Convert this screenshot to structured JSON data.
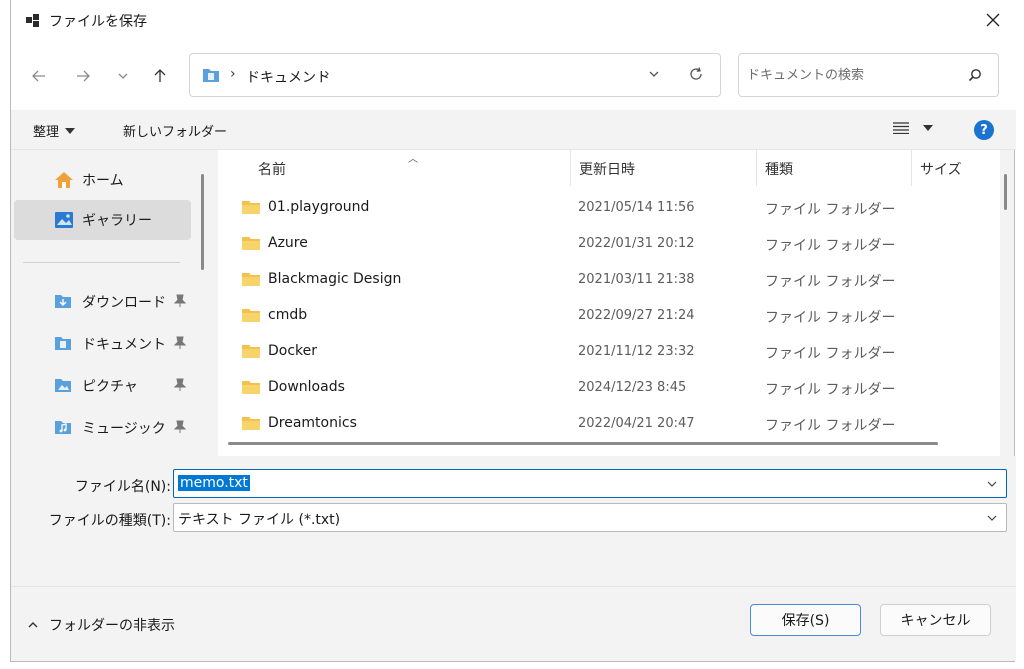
{
  "title": "ファイルを保存",
  "address": {
    "crumb": "ドキュメント",
    "sep": "›"
  },
  "search": {
    "placeholder": "ドキュメントの検索"
  },
  "toolbar": {
    "organize": "整理",
    "new_folder": "新しいフォルダー"
  },
  "sidebar": {
    "items": [
      {
        "label": "ホーム",
        "icon": "home-icon"
      },
      {
        "label": "ギャラリー",
        "icon": "gallery-icon",
        "selected": true
      },
      {
        "label": "ダウンロード",
        "icon": "downloads-folder-icon",
        "pinned": true
      },
      {
        "label": "ドキュメント",
        "icon": "documents-folder-icon",
        "pinned": true
      },
      {
        "label": "ピクチャ",
        "icon": "pictures-folder-icon",
        "pinned": true
      },
      {
        "label": "ミュージック",
        "icon": "music-folder-icon",
        "pinned": true
      }
    ]
  },
  "columns": {
    "name": "名前",
    "date": "更新日時",
    "type": "種類",
    "size": "サイズ"
  },
  "files": [
    {
      "name": "01.playground",
      "date": "2021/05/14 11:56",
      "type": "ファイル フォルダー"
    },
    {
      "name": "Azure",
      "date": "2022/01/31 20:12",
      "type": "ファイル フォルダー"
    },
    {
      "name": "Blackmagic Design",
      "date": "2021/03/11 21:38",
      "type": "ファイル フォルダー"
    },
    {
      "name": "cmdb",
      "date": "2022/09/27 21:24",
      "type": "ファイル フォルダー"
    },
    {
      "name": "Docker",
      "date": "2021/11/12 23:32",
      "type": "ファイル フォルダー"
    },
    {
      "name": "Downloads",
      "date": "2024/12/23 8:45",
      "type": "ファイル フォルダー"
    },
    {
      "name": "Dreamtonics",
      "date": "2022/04/21 20:47",
      "type": "ファイル フォルダー"
    }
  ],
  "filename": {
    "label": "ファイル名(N):",
    "value": "memo.txt"
  },
  "filetype": {
    "label": "ファイルの種類(T):",
    "value": "テキスト ファイル (*.txt)"
  },
  "footer": {
    "hide_folders": "フォルダーの非表示",
    "save": "保存(S)",
    "cancel": "キャンセル"
  },
  "colors": {
    "accent": "#0078d4",
    "folder": "#f2c14e",
    "help": "#1a73d1"
  }
}
